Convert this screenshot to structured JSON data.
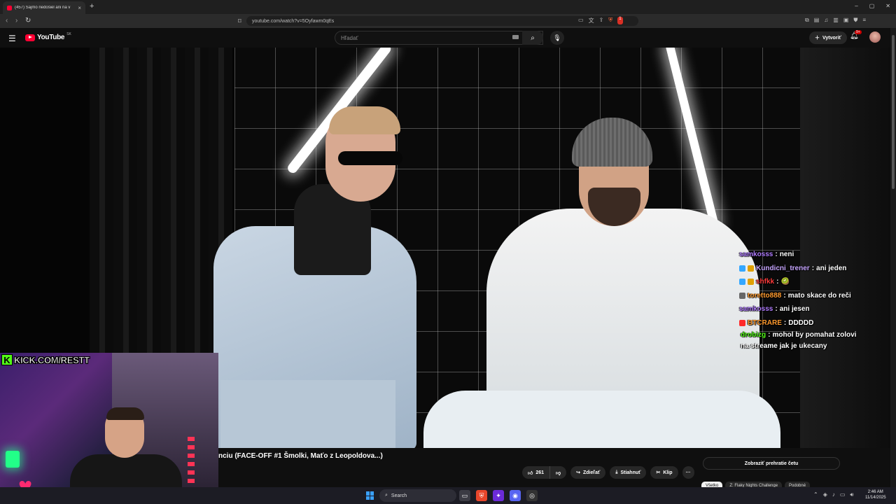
{
  "browser": {
    "tab_title": "(457) Šajmo nedošiel ani na v",
    "tab_close": "×",
    "new_tab": "+",
    "url": "youtube.com/watch?v=5Oyfawm0qEs",
    "window_controls": [
      "–",
      "▢",
      "✕"
    ],
    "ext_badge": "1"
  },
  "youtube": {
    "logo_text": "YouTube",
    "country_code": "SK",
    "search_placeholder": "Hľadať",
    "create_label": "Vytvoriť",
    "notif_count": "9+"
  },
  "stream_overlay": {
    "kick_url": "KICK.COM/RESTT"
  },
  "chat": [
    {
      "user": "samkosss",
      "color": "#b07cff",
      "text": "neni",
      "badges": []
    },
    {
      "user": "Kundicni_trener",
      "color": "#c7a6ff",
      "text": "ani jeden",
      "badges": [
        "#34a7ff",
        "#e0a000"
      ]
    },
    {
      "user": "shfkk",
      "color": "#ff3b3b",
      "text": "🥝",
      "badges": [
        "#34a7ff",
        "#e0a000"
      ]
    },
    {
      "user": "toretto888",
      "color": "#ff9a2e",
      "text": "mato skace do reči",
      "badges": [
        "#666666"
      ]
    },
    {
      "user": "samkosss",
      "color": "#b07cff",
      "text": "ani jesen",
      "badges": []
    },
    {
      "user": "BTCRARE",
      "color": "#ff9a2e",
      "text": "DDDDD",
      "badges": [
        "#ff2a2a"
      ]
    },
    {
      "user": "drobizg",
      "color": "#53fc18",
      "text": "mohol by pomahat zolovi na streame jak je ukecany",
      "badges": []
    }
  ],
  "video_info": {
    "title": "nciu (FACE-OFF #1 Šmolki, Maťo z Leopoldova...)",
    "likes": "261",
    "share_label": "Zdieľať",
    "download_label": "Stiahnuť",
    "clip_label": "Klip",
    "more_label": "···",
    "replay_chat_label": "Zobraziť prehratie četu",
    "chips": [
      "Všetko",
      "Z: Flaky Nights Challenge",
      "Podobné"
    ]
  },
  "taskbar": {
    "search_label": "Search",
    "time": "2:46 AM",
    "date": "11/14/2025"
  },
  "colors": {
    "accent_red": "#ff0033",
    "kick_green": "#53fc18",
    "bg": "#0f0f0f"
  }
}
